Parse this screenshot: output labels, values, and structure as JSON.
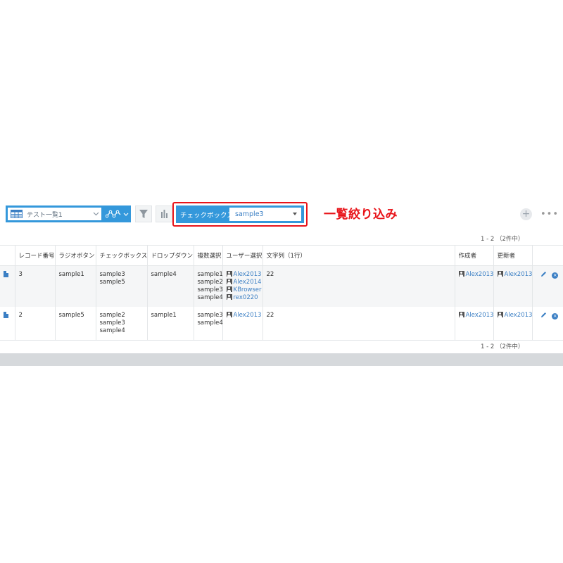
{
  "toolbar": {
    "view_select_label": "テスト一覧1",
    "filter_field_label": "チェックボックス",
    "filter_value": "sample3"
  },
  "annotation": "一覧絞り込み",
  "pager": {
    "top": "1 - 2 （2件中）",
    "bottom": "1 - 2 （2件中）"
  },
  "table": {
    "headers": [
      "レコード番号",
      "ラジオボタン",
      "チェックボックス",
      "ドロップダウン",
      "複数選択",
      "ユーザー選択",
      "文字列（1行）",
      "作成者",
      "更新者"
    ],
    "rows": [
      {
        "record_no": "3",
        "radio": "sample1",
        "checkbox": [
          "sample3",
          "sample5"
        ],
        "dropdown": "sample4",
        "multi": [
          "sample1",
          "sample2",
          "sample3",
          "sample4"
        ],
        "users": [
          "Alex2013",
          "Alex2014",
          "KBrowser",
          "rex0220"
        ],
        "text": "22",
        "creator": "Alex2013",
        "modifier": "Alex2013"
      },
      {
        "record_no": "2",
        "radio": "sample5",
        "checkbox": [
          "sample2",
          "sample3",
          "sample4"
        ],
        "dropdown": "sample1",
        "multi": [
          "sample3",
          "sample4"
        ],
        "users": [
          "Alex2013"
        ],
        "text": "22",
        "creator": "Alex2013",
        "modifier": "Alex2013"
      }
    ]
  },
  "icons": {
    "view": "table-icon",
    "graph": "line-graph-icon",
    "filter": "funnel-icon",
    "chart": "bar-chart-icon",
    "add": "plus-icon",
    "more": "ellipsis-icon",
    "record": "document-icon",
    "user": "user-icon",
    "edit": "pencil-icon",
    "delete": "close-circle-icon"
  },
  "colors": {
    "accent": "#3498db",
    "link": "#3b7fc4",
    "highlight": "#e8141a"
  }
}
